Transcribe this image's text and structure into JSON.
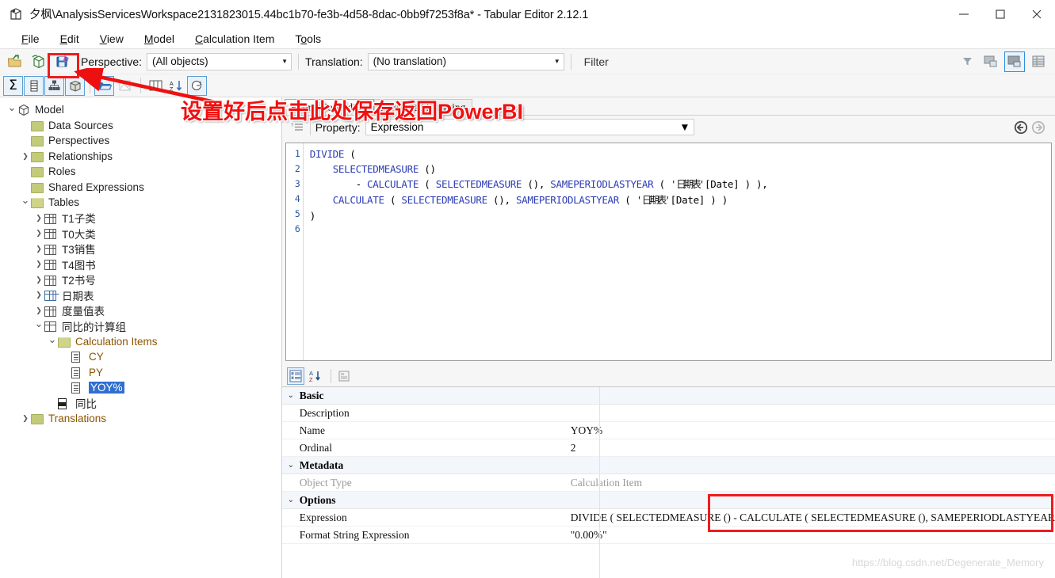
{
  "window": {
    "title": "夕枫\\AnalysisServicesWorkspace2131823015.44bc1b70-fe3b-4d58-8dac-0bb9f7253f8a* - Tabular Editor 2.12.1",
    "app_icon": "tabular-editor-icon",
    "minimize": "–",
    "maximize": "□",
    "close": "✕"
  },
  "menubar": [
    {
      "pre": "",
      "key": "F",
      "post": "ile"
    },
    {
      "pre": "",
      "key": "E",
      "post": "dit"
    },
    {
      "pre": "",
      "key": "V",
      "post": "iew"
    },
    {
      "pre": "",
      "key": "M",
      "post": "odel"
    },
    {
      "pre": "",
      "key": "C",
      "post": "alculation Item"
    },
    {
      "pre": "T",
      "key": "o",
      "post": "ols"
    }
  ],
  "toolbar": {
    "icons": [
      "open-file-icon",
      "connect-database-icon",
      "save-model-icon"
    ],
    "perspective_label": "Perspective:",
    "perspective_value": "(All objects)",
    "translation_label": "Translation:",
    "translation_value": "(No translation)",
    "filter_placeholder": "Filter",
    "right_icons": [
      "filter-icon",
      "hide-preview-icon",
      "show-preview-icon",
      "grid-view-icon"
    ]
  },
  "toolbar2": {
    "icons": [
      "measures-toggle-icon",
      "columns-toggle-icon",
      "hierarchies-toggle-icon",
      "partitions-toggle-icon",
      "display-folders-icon",
      "hidden-objects-icon",
      "all-columns-icon",
      "sort-alphabetically-icon",
      "object-counts-icon"
    ]
  },
  "annotation": {
    "text": "设置好后点击此处保存返回PowerBI",
    "arrow": "red-arrow"
  },
  "tree": [
    {
      "depth": 0,
      "exp": "v",
      "icon": "model-cube-icon",
      "label": "Model",
      "style": "plain"
    },
    {
      "depth": 1,
      "exp": "",
      "icon": "folder-icon",
      "label": "Data Sources",
      "style": "plain"
    },
    {
      "depth": 1,
      "exp": "",
      "icon": "folder-icon",
      "label": "Perspectives",
      "style": "plain"
    },
    {
      "depth": 1,
      "exp": ">",
      "icon": "folder-icon",
      "label": "Relationships",
      "style": "plain"
    },
    {
      "depth": 1,
      "exp": "",
      "icon": "folder-icon",
      "label": "Roles",
      "style": "plain"
    },
    {
      "depth": 1,
      "exp": "",
      "icon": "folder-icon",
      "label": "Shared Expressions",
      "style": "plain"
    },
    {
      "depth": 1,
      "exp": "v",
      "icon": "folder-open-icon",
      "label": "Tables",
      "style": "plain"
    },
    {
      "depth": 2,
      "exp": ">",
      "icon": "table-icon",
      "label": "T1子类",
      "style": "plain"
    },
    {
      "depth": 2,
      "exp": ">",
      "icon": "table-icon",
      "label": "T0大类",
      "style": "plain"
    },
    {
      "depth": 2,
      "exp": ">",
      "icon": "table-icon",
      "label": "T3销售",
      "style": "plain"
    },
    {
      "depth": 2,
      "exp": ">",
      "icon": "table-icon",
      "label": "T4图书",
      "style": "plain"
    },
    {
      "depth": 2,
      "exp": ">",
      "icon": "table-icon",
      "label": "T2书号",
      "style": "plain"
    },
    {
      "depth": 2,
      "exp": ">",
      "icon": "calculated-table-icon",
      "label": "日期表",
      "style": "plain"
    },
    {
      "depth": 2,
      "exp": ">",
      "icon": "table-icon",
      "label": "度量值表",
      "style": "plain"
    },
    {
      "depth": 2,
      "exp": "v",
      "icon": "calculation-group-icon",
      "label": "同比的计算组",
      "style": "plain"
    },
    {
      "depth": 3,
      "exp": "v",
      "icon": "folder-open-icon",
      "label": "Calculation Items",
      "style": "orange"
    },
    {
      "depth": 4,
      "exp": "",
      "icon": "calculation-item-icon",
      "label": "CY",
      "style": "orange"
    },
    {
      "depth": 4,
      "exp": "",
      "icon": "calculation-item-icon",
      "label": "PY",
      "style": "orange"
    },
    {
      "depth": 4,
      "exp": "",
      "icon": "calculation-item-icon",
      "label": "YOY%",
      "style": "selected"
    },
    {
      "depth": 3,
      "exp": "",
      "icon": "measure-icon",
      "label": "同比",
      "style": "plain"
    },
    {
      "depth": 1,
      "exp": ">",
      "icon": "folder-icon",
      "label": "Translations",
      "style": "orange"
    }
  ],
  "editor": {
    "tabs": [
      {
        "label": "Expression Editor",
        "active": true
      },
      {
        "label": "Advanced Scripting",
        "active": false
      }
    ],
    "format_icon": "format-code-icon",
    "property_label": "Property:",
    "property_value": "Expression",
    "nav_back_icon": "nav-back-icon",
    "nav_forward_icon": "nav-forward-icon",
    "line_numbers": [
      "1",
      "2",
      "3",
      "4",
      "5",
      "6"
    ],
    "code_lines": [
      "DIVIDE (",
      "    SELECTEDMEASURE ()",
      "        - CALCULATE ( SELECTEDMEASURE (), SAMEPERIODLASTYEAR ( '日期表'[Date] ) ),",
      "    CALCULATE ( SELECTEDMEASURE (), SAMEPERIODLASTYEAR ( '日期表'[Date] ) )",
      ")",
      ""
    ]
  },
  "properties": {
    "toolbar_icons": [
      "categorized-view-icon",
      "alphabetical-sort-icon",
      "property-pages-icon"
    ],
    "groups": [
      {
        "name": "Basic",
        "rows": [
          {
            "name": "Description",
            "value": "",
            "readonly": false
          },
          {
            "name": "Name",
            "value": "YOY%",
            "readonly": false
          },
          {
            "name": "Ordinal",
            "value": "2",
            "readonly": false
          }
        ]
      },
      {
        "name": "Metadata",
        "rows": [
          {
            "name": "Object Type",
            "value": "Calculation Item",
            "readonly": true
          }
        ]
      },
      {
        "name": "Options",
        "rows": [
          {
            "name": "Expression",
            "value": "DIVIDE (    SELECTEDMEASURE ()        - CALCULATE ( SELECTEDMEASURE (), SAMEPERIODLASTYEAR",
            "readonly": false
          },
          {
            "name": "Format String Expression",
            "value": "\"0.00%\"",
            "readonly": false
          }
        ]
      }
    ]
  },
  "watermark": "https://blog.csdn.net/Degenerate_Memory"
}
